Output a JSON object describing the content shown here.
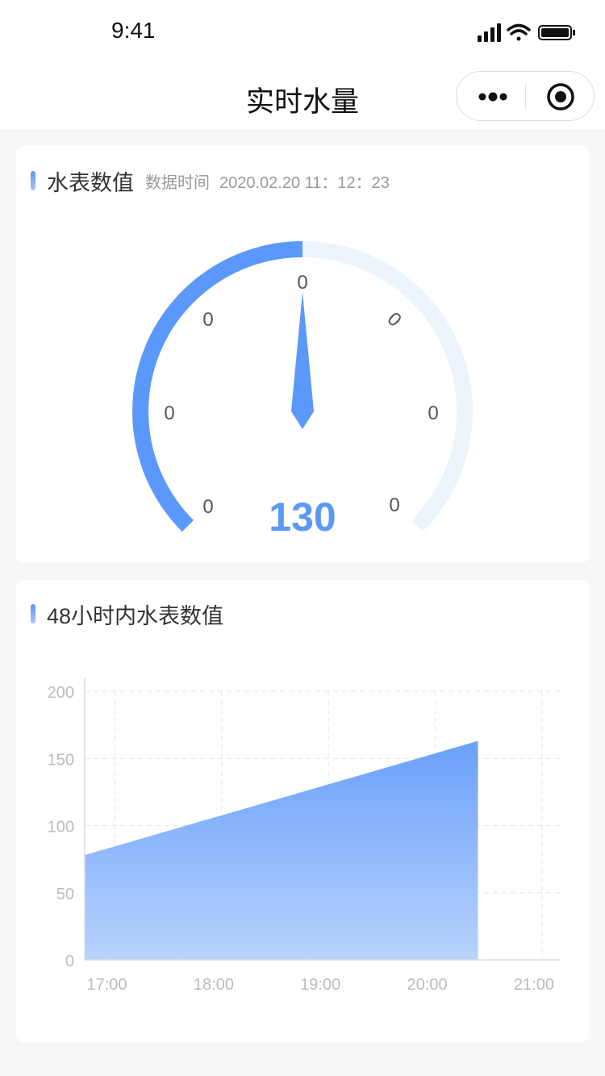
{
  "status_bar": {
    "time": "9:41"
  },
  "nav": {
    "title": "实时水量"
  },
  "meter_card": {
    "title": "水表数值",
    "data_time_label": "数据时间",
    "data_time_value": "2020.02.20  11：12：23"
  },
  "gauge": {
    "value": 130,
    "value_text": "130",
    "progress_fraction": 0.5,
    "tick_labels": [
      "0",
      "0",
      "0",
      "0",
      "0",
      "0",
      "0"
    ],
    "colors": {
      "active": "#5b98fb",
      "track": "#edf3fb",
      "needle": "#5b98fb"
    }
  },
  "chart_card": {
    "title": "48小时内水表数值"
  },
  "chart_data": {
    "type": "area",
    "x": [
      "16:43",
      "20:24"
    ],
    "values": [
      78,
      163
    ],
    "x_ticks": [
      "17:00",
      "18:00",
      "19:00",
      "20:00",
      "21:00"
    ],
    "y_ticks": [
      "0",
      "50",
      "100",
      "150",
      "200"
    ],
    "ylim": [
      0,
      200
    ],
    "xlim": [
      "16:43",
      "21:10"
    ],
    "grid": true,
    "colors": {
      "fill_top": "#6aa0fa",
      "fill_bottom": "#b7d3fd"
    }
  }
}
